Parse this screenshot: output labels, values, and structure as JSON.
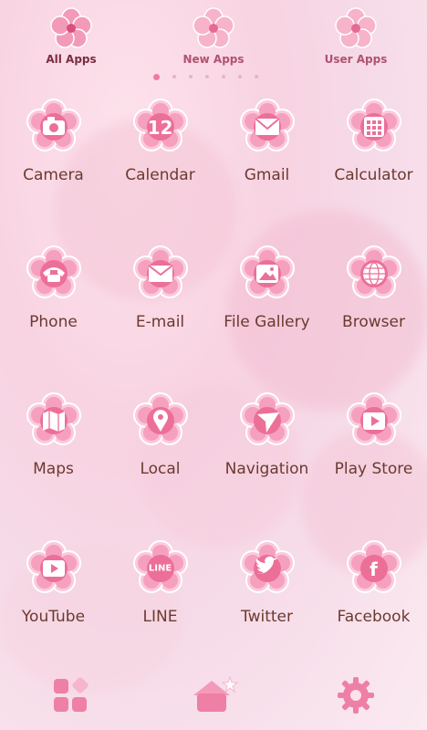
{
  "tabs": [
    {
      "label": "All Apps",
      "active": true
    },
    {
      "label": "New Apps",
      "active": false
    },
    {
      "label": "User Apps",
      "active": false
    }
  ],
  "page_indicator": {
    "count": 7,
    "active_index": 0
  },
  "apps": [
    {
      "name": "Camera",
      "icon": "camera-icon"
    },
    {
      "name": "Calendar",
      "icon": "calendar-icon",
      "glyph": "12"
    },
    {
      "name": "Gmail",
      "icon": "gmail-icon"
    },
    {
      "name": "Calculator",
      "icon": "calculator-icon"
    },
    {
      "name": "Phone",
      "icon": "phone-icon"
    },
    {
      "name": "E-mail",
      "icon": "email-icon"
    },
    {
      "name": "File Gallery",
      "icon": "gallery-icon"
    },
    {
      "name": "Browser",
      "icon": "browser-icon"
    },
    {
      "name": "Maps",
      "icon": "maps-icon"
    },
    {
      "name": "Local",
      "icon": "local-pin-icon"
    },
    {
      "name": "Navigation",
      "icon": "navigation-icon"
    },
    {
      "name": "Play Store",
      "icon": "play-store-icon"
    },
    {
      "name": "YouTube",
      "icon": "youtube-icon"
    },
    {
      "name": "LINE",
      "icon": "line-icon",
      "glyph": "LINE"
    },
    {
      "name": "Twitter",
      "icon": "twitter-icon"
    },
    {
      "name": "Facebook",
      "icon": "facebook-icon",
      "glyph": "f"
    }
  ],
  "dock": [
    {
      "icon": "app-drawer-icon"
    },
    {
      "icon": "home-icon"
    },
    {
      "icon": "settings-gear-icon"
    }
  ],
  "colors": {
    "petal": "#f7a9c4",
    "petal_dark": "#ec6f98",
    "text": "#6b3a2f",
    "tab_text": "#b0526f"
  }
}
